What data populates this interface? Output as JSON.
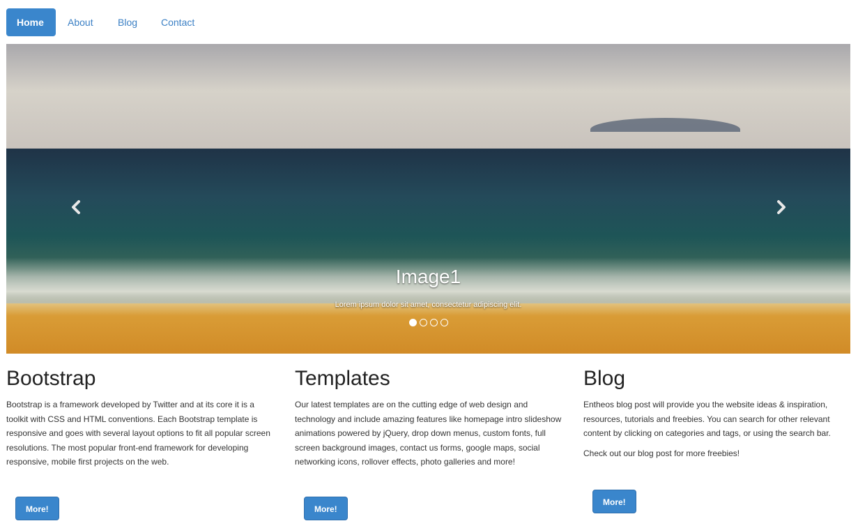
{
  "nav": {
    "items": [
      {
        "label": "Home",
        "active": true
      },
      {
        "label": "About",
        "active": false
      },
      {
        "label": "Blog",
        "active": false
      },
      {
        "label": "Contact",
        "active": false
      }
    ]
  },
  "carousel": {
    "caption_title": "Image1",
    "caption_text": "Lorem ipsum dolor sit amet, consectetur adipiscing elit.",
    "prev_icon": "chevron-left-icon",
    "next_icon": "chevron-right-icon",
    "slide_count": 4,
    "active_slide": 1
  },
  "columns": [
    {
      "title": "Bootstrap",
      "paragraphs": [
        "Bootstrap is a framework developed by Twitter and at its core it is a toolkit with CSS and HTML conventions. Each Bootstrap template is responsive and goes with several layout options to fit all popular screen resolutions. The most popular front-end framework for developing responsive, mobile first projects on the web."
      ],
      "button": "More!"
    },
    {
      "title": "Templates",
      "paragraphs": [
        "Our latest templates are on the cutting edge of web design and technology and include amazing features like homepage intro slideshow animations powered by jQuery, drop down menus, custom fonts, full screen background images, contact us forms, google maps, social networking icons, rollover effects, photo galleries and more!"
      ],
      "button": "More!"
    },
    {
      "title": "Blog",
      "paragraphs": [
        "Entheos blog post will provide you the website ideas & inspiration, resources, tutorials and freebies. You can search for other relevant content by clicking on categories and tags, or using the search bar.",
        "Check out our blog post for more freebies!"
      ],
      "button": "More!"
    }
  ],
  "colors": {
    "accent": "#3a86cc",
    "link": "#3a7fc4"
  }
}
